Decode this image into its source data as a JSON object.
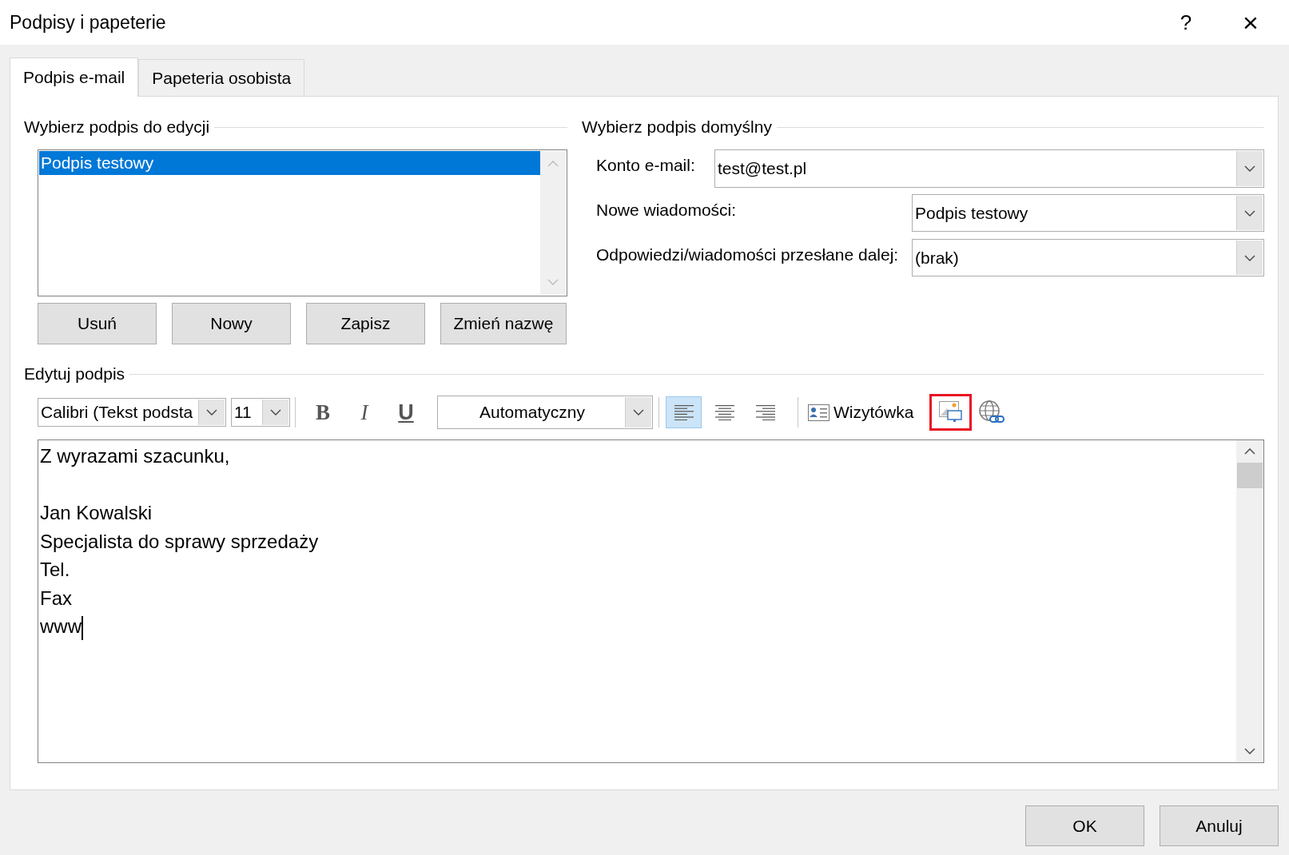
{
  "window": {
    "title": "Podpisy i papeterie",
    "help_button": "?",
    "close_button": "×"
  },
  "tabs": [
    {
      "label": "Podpis e-mail",
      "selected": true
    },
    {
      "label": "Papeteria osobista",
      "selected": false
    }
  ],
  "select_signature": {
    "title": "Wybierz podpis do edycji",
    "items": [
      {
        "label": "Podpis testowy",
        "selected": true
      }
    ],
    "buttons": [
      "Usuń",
      "Nowy",
      "Zapisz",
      "Zmień nazwę"
    ]
  },
  "default_signature": {
    "title": "Wybierz podpis domyślny",
    "fields": [
      {
        "label": "Konto e-mail:",
        "value": "test@test.pl",
        "kind": "wide"
      },
      {
        "label": "Nowe wiadomości:",
        "value": "Podpis testowy",
        "kind": "narrow"
      },
      {
        "label": "Odpowiedzi/wiadomości przesłane dalej:",
        "value": "(brak)",
        "kind": "narrow"
      }
    ]
  },
  "edit_signature": {
    "title": "Edytuj podpis",
    "toolbar": {
      "font": "Calibri (Tekst podsta",
      "size": "11",
      "bold": "B",
      "italic": "I",
      "underline": "U",
      "font_color_picker": "Automatyczny",
      "alignment": [
        {
          "kind": "left",
          "selected": true
        },
        {
          "kind": "center",
          "selected": false
        },
        {
          "kind": "right",
          "selected": false
        }
      ],
      "business_card": "Wizytówka",
      "insert_picture_highlighted": true
    },
    "body": [
      {
        "lines": [
          "Z wyrazami szacunku,"
        ]
      },
      {
        "lines": [
          "Jan Kowalski",
          "Specjalista do sprawy sprzedaży",
          "Tel.",
          "Fax",
          "www"
        ]
      }
    ],
    "cursor": true
  },
  "buttons": [
    "OK",
    "Anuluj"
  ]
}
